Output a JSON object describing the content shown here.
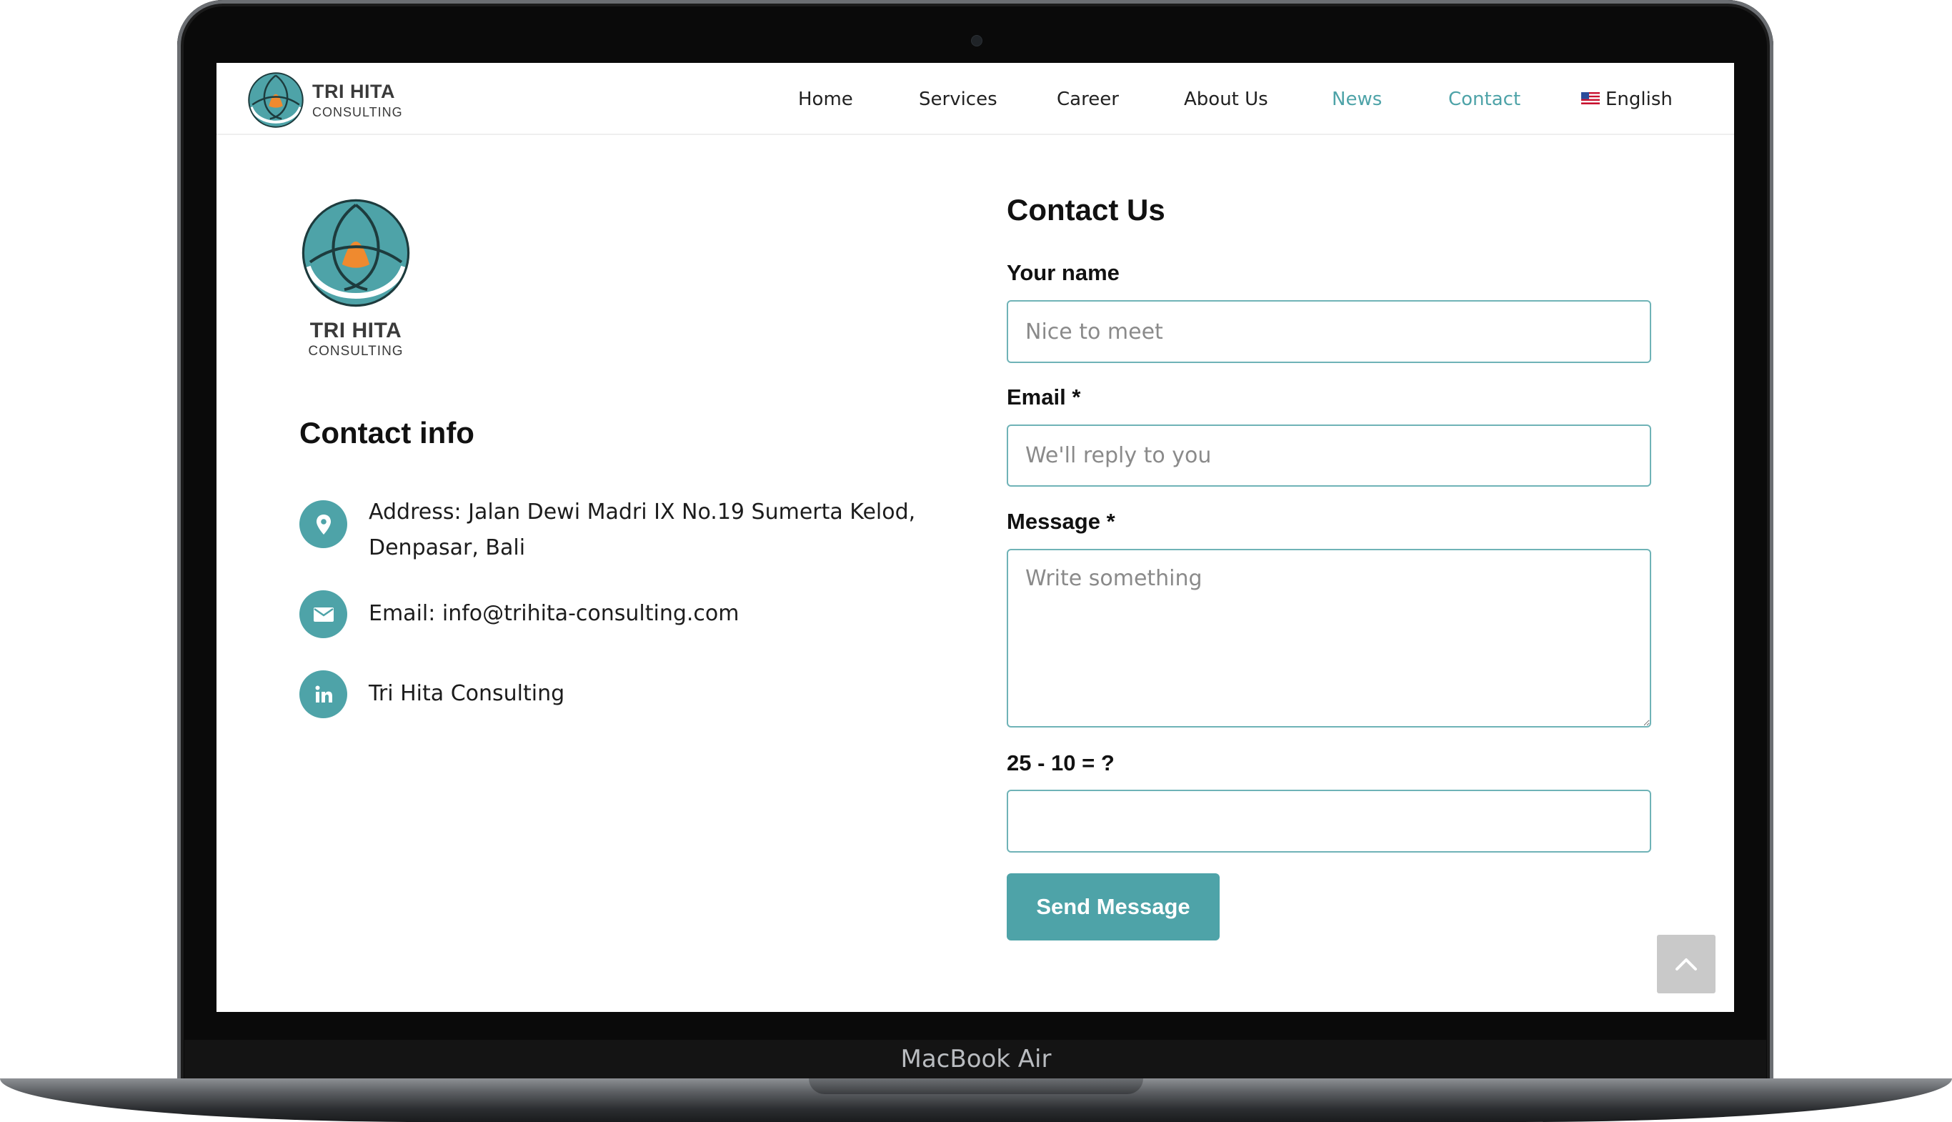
{
  "device": {
    "label": "MacBook Air"
  },
  "brand": {
    "name": "TRI HITA",
    "subtitle": "CONSULTING"
  },
  "nav": {
    "items": [
      {
        "label": "Home"
      },
      {
        "label": "Services"
      },
      {
        "label": "Career"
      },
      {
        "label": "About Us"
      },
      {
        "label": "News"
      },
      {
        "label": "Contact"
      }
    ],
    "language": "English"
  },
  "contact_info": {
    "heading": "Contact info",
    "address": "Address: Jalan Dewi Madri IX No.19 Sumerta Kelod, Denpasar, Bali",
    "email": "Email: info@trihita-consulting.com",
    "linkedin": "Tri Hita Consulting"
  },
  "form": {
    "heading": "Contact Us",
    "name_label": "Your name",
    "name_placeholder": "Nice to meet",
    "email_label": "Email *",
    "email_placeholder": "We'll reply to you",
    "message_label": "Message *",
    "message_placeholder": "Write something",
    "captcha_label": "25 - 10 = ?",
    "captcha_value": "",
    "submit_label": "Send Message"
  },
  "colors": {
    "accent": "#4ea3a8",
    "logo_orange": "#ef8a2f",
    "text": "#111111"
  },
  "icons": [
    "location-pin-icon",
    "envelope-icon",
    "linkedin-icon",
    "chevron-up-icon",
    "us-flag-icon"
  ]
}
